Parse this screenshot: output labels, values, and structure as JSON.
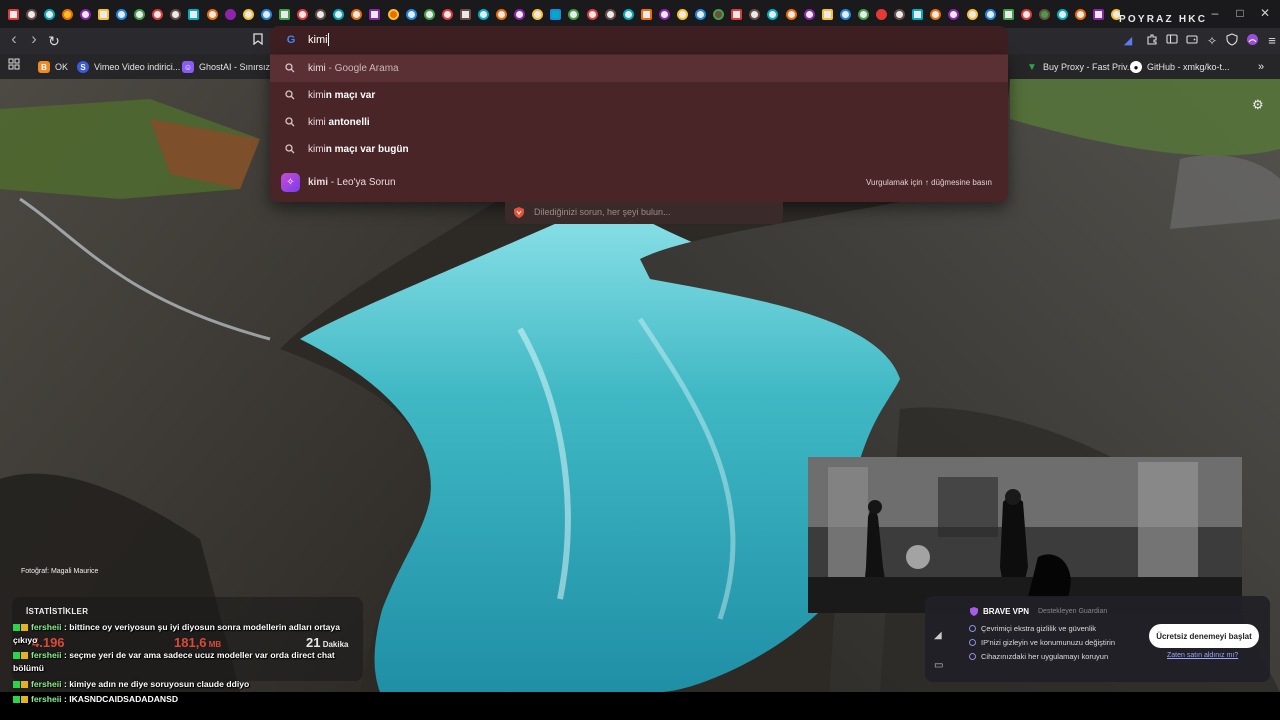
{
  "tabstrip": {
    "tab_count": 63,
    "active_tab_close": "×",
    "new_tab": "+",
    "brand": "POYRAZ HKC"
  },
  "toolbar": {
    "back": "‹",
    "forward": "›",
    "reload": "↻",
    "bookmark": "🔖"
  },
  "omnibox": {
    "engine_glyph": "G",
    "value": "kimi"
  },
  "suggestions": [
    {
      "prefix": "kimi",
      "bold": "",
      "suffix": " - Google Arama"
    },
    {
      "prefix": "kimi",
      "bold": "n maçı var",
      "suffix": ""
    },
    {
      "prefix": "kimi",
      "bold": " antonelli",
      "suffix": ""
    },
    {
      "prefix": "kimi",
      "bold": "n maçı var bugün",
      "suffix": ""
    }
  ],
  "leo": {
    "query": "kimi",
    "label": " - Leo'ya Sorun",
    "hint": "Vurgulamak için ↑ düğmesine basın"
  },
  "askbox": {
    "placeholder": "Dilediğinizi sorun, her şeyi bulun..."
  },
  "bookmarks": {
    "left": [
      {
        "label": "OK",
        "color": "#f08a24"
      },
      {
        "label": "Vimeo Video indirici...",
        "color": "#3b5bdb"
      },
      {
        "label": "GhostAI - Sınırsız AI...",
        "color": "#8a5cf6"
      }
    ],
    "right": [
      {
        "label": "Buy Proxy - Fast Priv...",
        "color": "#2aa44f"
      },
      {
        "label": "GitHub - xmkg/ko-t...",
        "color": "#111111"
      }
    ],
    "more": "»"
  },
  "photo_credit": "Fotoğraf: Magali Maurice",
  "stats": {
    "title": "İSTATİSTİKLER",
    "values": [
      {
        "value": "4.196",
        "unit": "",
        "color": "#d94a3a"
      },
      {
        "value": "181,6",
        "unit": " MB",
        "color": "#d94a3a"
      },
      {
        "value": "21",
        "unit": " Dakika",
        "color": "#e8e8e8"
      }
    ]
  },
  "chat": [
    {
      "user": "fersheii",
      "message": " : bittince oy veriyosun şu iyi diyosun sonra modellerin adları ortaya çıkıyo"
    },
    {
      "user": "fersheii",
      "message": " : seçme yeri de var ama sadece ucuz modeller var orda direct chat bölümü"
    },
    {
      "user": "fersheii",
      "message": " : kimiye adın ne diye soruyosun claude ddiyo"
    },
    {
      "user": "fersheii",
      "message": " : IKASNDCAIDSADADANSD"
    }
  ],
  "vpn": {
    "title": "BRAVE VPN",
    "subtitle": "Destekleyen   Guardian",
    "features": [
      "Çevrimiçi ekstra gizlilik ve güvenlik",
      "IP'nizi gizleyin ve konumunuzu değiştirin",
      "Cihazınızdaki her uygulamayı koruyun"
    ],
    "button": "Ücretsiz denemeyi başlat",
    "link": "Zaten satın aldınız mı?"
  },
  "colors": {
    "omnibox_bg": "#3d1f22",
    "dropdown_bg": "#4a2528",
    "selected_row": "#5a3034",
    "water": "#3fb8c4"
  }
}
